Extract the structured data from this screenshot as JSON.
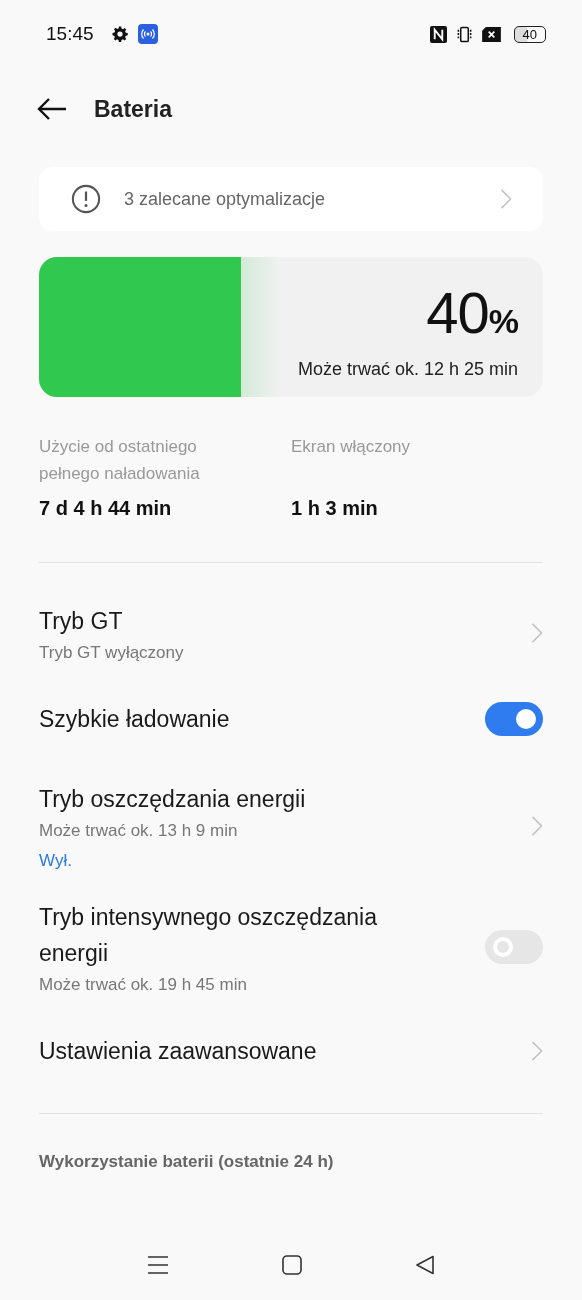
{
  "status_bar": {
    "time": "15:45",
    "battery": "40"
  },
  "header": {
    "title": "Bateria"
  },
  "optimizations": {
    "label": "3 zalecane optymalizacje"
  },
  "battery": {
    "level": 0.4,
    "percent": "40",
    "unit": "%",
    "estimate": "Może trwać ok. 12 h 25 min"
  },
  "stats": [
    {
      "label": "Użycie od ostatniego pełnego naładowania",
      "value": "7 d 4 h 44 min"
    },
    {
      "label": "Ekran włączony",
      "value": "1 h 3 min"
    }
  ],
  "settings": [
    {
      "kind": "chevron",
      "title": "Tryb GT",
      "subtitle": "Tryb GT wyłączony"
    },
    {
      "kind": "toggle",
      "title": "Szybkie ładowanie",
      "on": true
    },
    {
      "kind": "chevron",
      "title": "Tryb oszczędzania energii",
      "subtitle": "Może trwać ok. 13 h 9 min",
      "status": "Wył."
    },
    {
      "kind": "toggle",
      "title": "Tryb intensywnego oszczędzania energii",
      "subtitle": "Może trwać ok. 19 h 45 min",
      "on": false
    },
    {
      "kind": "chevron",
      "title": "Ustawienia zaawansowane"
    }
  ],
  "section_title": "Wykorzystanie baterii (ostatnie 24 h)"
}
